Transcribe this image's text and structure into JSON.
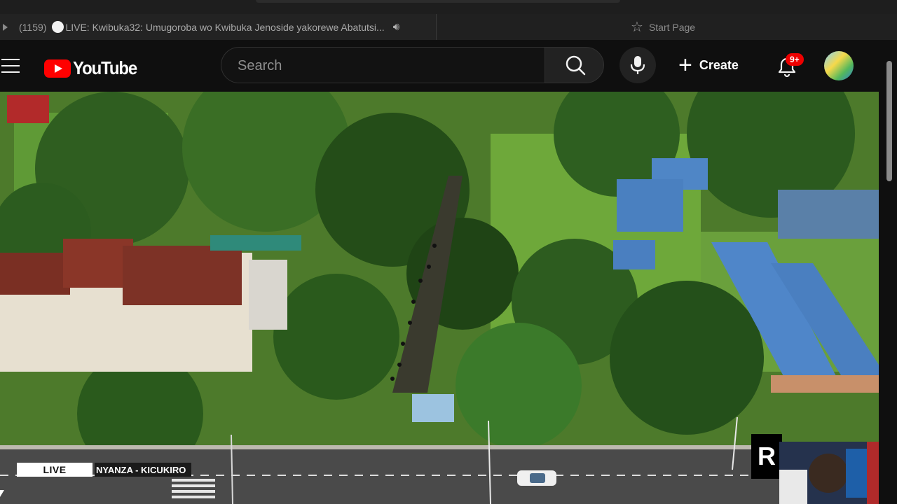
{
  "browser": {
    "active_tab": {
      "count": "(1159)",
      "title": "LIVE: Kwibuka32: Umugoroba wo Kwibuka Jenoside yakorewe Abatutsi..."
    },
    "start_tab": {
      "title": "Start Page"
    }
  },
  "youtube": {
    "logo_text": "YouTube",
    "search_placeholder": "Search",
    "create_label": "Create",
    "notification_badge": "9+"
  },
  "video": {
    "live_label": "LIVE",
    "location_label": "NYANZA - KICUKIRO",
    "channel_logo_text": "R"
  },
  "colors": {
    "youtube_red": "#ff0000",
    "badge_red": "#e00000",
    "background": "#0f0f0f"
  }
}
